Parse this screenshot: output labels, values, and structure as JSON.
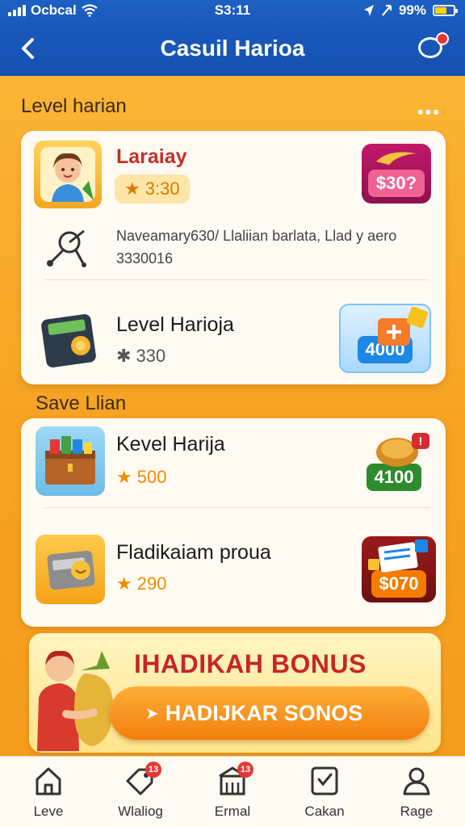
{
  "status_bar": {
    "carrier": "Ocbcal",
    "time": "S3:11",
    "battery": "99%"
  },
  "header": {
    "title": "Casuil Harioa"
  },
  "section1": {
    "title": "Level harian",
    "items": [
      {
        "title": "Laraiay",
        "points": "3:30",
        "reward": "$30?"
      },
      {
        "description": "Naveamary630/ Llaliian barlata, Llad y aero 3330016"
      },
      {
        "title": "Level Harioja",
        "points": "330",
        "reward": "4000"
      }
    ]
  },
  "section2": {
    "title": "Save Llian",
    "items": [
      {
        "title": "Kevel Harija",
        "points": "500",
        "reward": "4100"
      },
      {
        "title": "Fladikaiam proua",
        "points": "290",
        "reward": "$070"
      }
    ]
  },
  "banner": {
    "title": "IHADIKAH BONUS",
    "button_label": "HADIJKAR SONOS"
  },
  "bottom_nav": [
    {
      "label": "Leve"
    },
    {
      "label": "Wlaliog",
      "badge": "13"
    },
    {
      "label": "Ermal",
      "badge": "13"
    },
    {
      "label": "Cakan"
    },
    {
      "label": "Rage"
    }
  ],
  "colors": {
    "header_blue": "#1d5fc2",
    "background_orange": "#f6a62a",
    "accent_red": "#c62626",
    "points_orange": "#f08c00",
    "reward_green": "#2e8b2e",
    "reward_blue": "#1e88e5"
  }
}
